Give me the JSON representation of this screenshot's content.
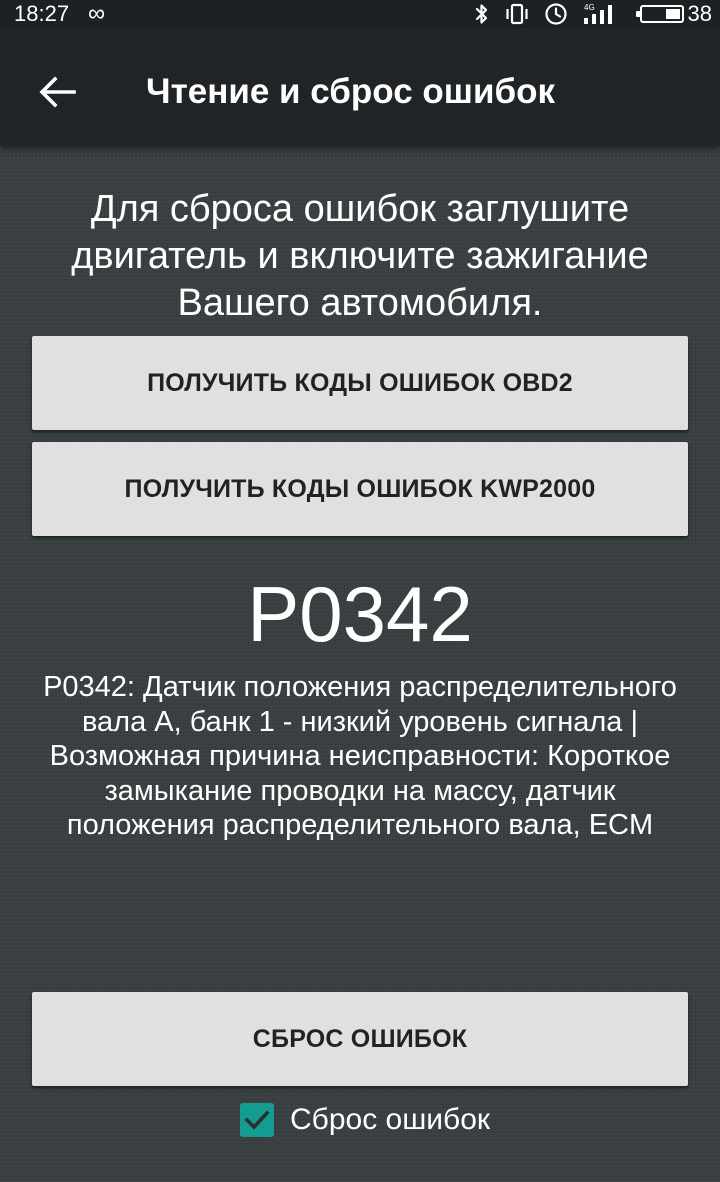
{
  "status_bar": {
    "time": "18:27",
    "link_symbol": "∞",
    "network": "4G",
    "battery_level": "38",
    "icons": [
      "link-icon",
      "bluetooth-icon",
      "vibrate-icon",
      "alarm-icon",
      "signal-icon",
      "battery-icon"
    ]
  },
  "app_bar": {
    "title": "Чтение и сброс ошибок",
    "back_icon": "arrow-left-icon"
  },
  "main": {
    "instruction": "Для сброса ошибок заглушите двигатель и включите зажигание Вашего автомобиля.",
    "button_obd2": "ПОЛУЧИТЬ КОДЫ ОШИБОК OBD2",
    "button_kwp2000": "ПОЛУЧИТЬ КОДЫ ОШИБОК KWP2000",
    "error_code": "P0342",
    "error_description": "P0342: Датчик положения распределительного вала A, банк 1 - низкий уровень сигнала | Возможная причина неисправности: Короткое замыкание проводки на массу, датчик положения распределительного вала, ECM",
    "button_reset": "СБРОС ОШИБОК",
    "checkbox_label": "Сброс ошибок",
    "checkbox_checked": true
  },
  "colors": {
    "accent": "#139c8f",
    "background": "#3b4143",
    "app_bar": "#212426",
    "button": "#e0e0e0"
  }
}
